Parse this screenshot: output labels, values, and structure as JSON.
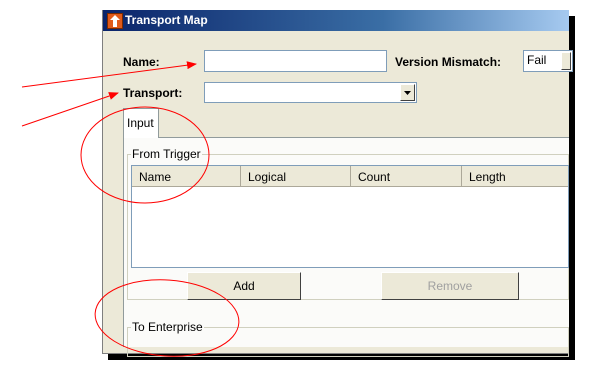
{
  "window": {
    "title": "Transport Map"
  },
  "form": {
    "name_label": "Name:",
    "name_value": "",
    "transport_label": "Transport:",
    "transport_value": "",
    "version_mismatch_label": "Version Mismatch:",
    "version_mismatch_value": "Fail"
  },
  "tabs": [
    {
      "label": "Input"
    }
  ],
  "from_trigger": {
    "legend": "From Trigger",
    "columns": [
      "Name",
      "Logical",
      "Count",
      "Length"
    ],
    "rows": [],
    "add_label": "Add",
    "remove_label": "Remove"
  },
  "to_enterprise": {
    "legend": "To Enterprise"
  },
  "annotation_color": "#ff0000"
}
